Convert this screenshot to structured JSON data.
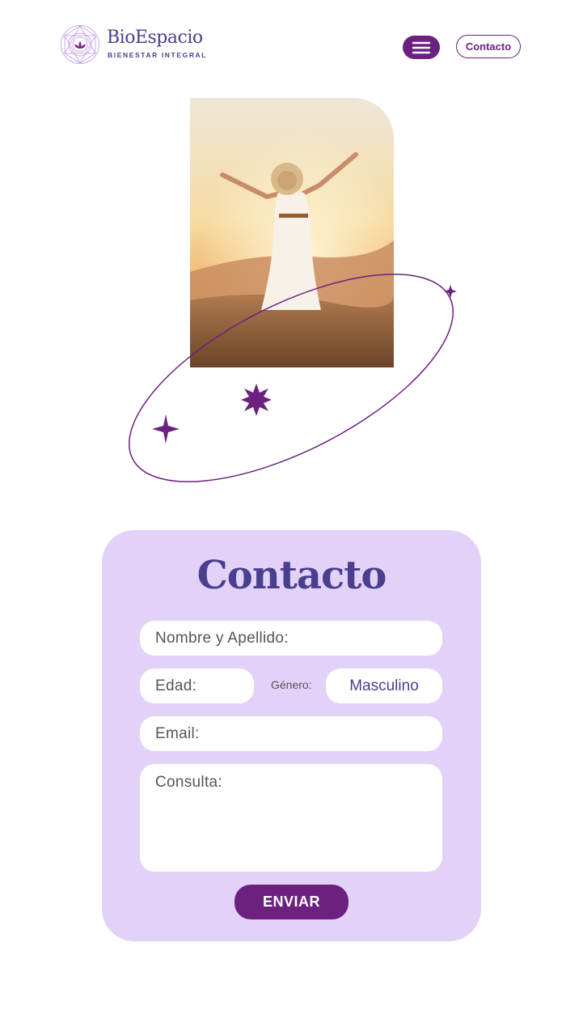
{
  "header": {
    "brand_name": "BioEspacio",
    "brand_tagline": "BIENESTAR INTEGRAL",
    "menu_icon": "hamburger-menu-icon",
    "contact_label": "Contacto"
  },
  "colors": {
    "primary": "#6c2180",
    "title": "#4a3e8f",
    "card_bg": "#e3d2f8"
  },
  "form": {
    "title": "Contacto",
    "name_placeholder": "Nombre y Apellido:",
    "age_placeholder": "Edad:",
    "gender_label": "Género:",
    "gender_value": "Masculino",
    "email_placeholder": "Email:",
    "message_placeholder": "Consulta:",
    "submit_label": "ENVIAR"
  }
}
